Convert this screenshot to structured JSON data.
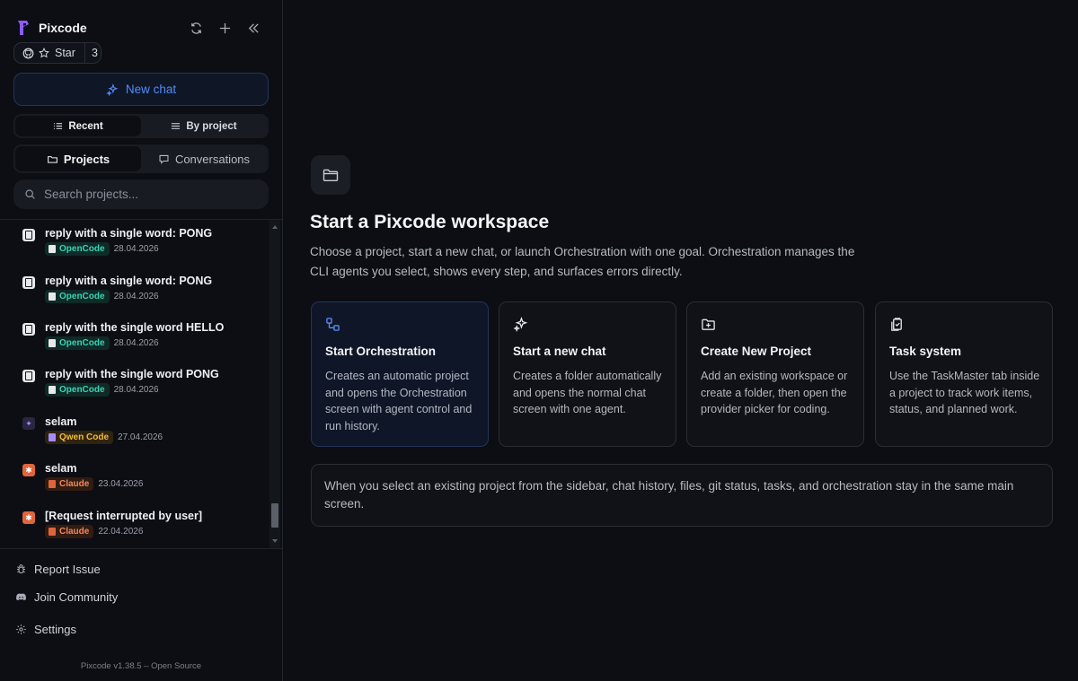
{
  "app": {
    "name": "Pixcode",
    "version_text": "Pixcode v1.38.5 – Open Source"
  },
  "star": {
    "label": "Star",
    "count": "3"
  },
  "new_chat": {
    "label": "New chat"
  },
  "view_toggle": {
    "recent": "Recent",
    "by_project": "By project",
    "active": "Recent"
  },
  "tabs": {
    "projects": "Projects",
    "conversations": "Conversations",
    "active": "Projects"
  },
  "search": {
    "placeholder": "Search projects..."
  },
  "sessions": [
    {
      "title": "reply with a single word: PONG",
      "provider": "OpenCode",
      "date": "28.04.2026",
      "icon": "opencode-icon"
    },
    {
      "title": "reply with a single word: PONG",
      "provider": "OpenCode",
      "date": "28.04.2026",
      "icon": "opencode-icon"
    },
    {
      "title": "reply with the single word HELLO",
      "provider": "OpenCode",
      "date": "28.04.2026",
      "icon": "opencode-icon"
    },
    {
      "title": "reply with the single word PONG",
      "provider": "OpenCode",
      "date": "28.04.2026",
      "icon": "opencode-icon"
    },
    {
      "title": "selam",
      "provider": "Qwen Code",
      "date": "27.04.2026",
      "icon": "qwen-icon"
    },
    {
      "title": "selam",
      "provider": "Claude",
      "date": "23.04.2026",
      "icon": "claude-icon"
    },
    {
      "title": "[Request interrupted by user]",
      "provider": "Claude",
      "date": "22.04.2026",
      "icon": "claude-icon"
    }
  ],
  "footer": {
    "report_issue": "Report Issue",
    "join_community": "Join Community",
    "settings": "Settings"
  },
  "main": {
    "title": "Start a Pixcode workspace",
    "description": "Choose a project, start a new chat, or launch Orchestration with one goal. Orchestration manages the CLI agents you select, shows every step, and surfaces errors directly.",
    "cards": [
      {
        "title": "Start Orchestration",
        "body": "Creates an automatic project and opens the Orchestration screen with agent control and run history.",
        "icon": "orchestration-icon"
      },
      {
        "title": "Start a new chat",
        "body": "Creates a folder automatically and opens the normal chat screen with one agent.",
        "icon": "sparkles-icon"
      },
      {
        "title": "Create New Project",
        "body": "Add an existing workspace or create a folder, then open the provider picker for coding.",
        "icon": "folder-plus-icon"
      },
      {
        "title": "Task system",
        "body": "Use the TaskMaster tab inside a project to track work items, status, and planned work.",
        "icon": "clipboard-icon"
      }
    ],
    "info": "When you select an existing project from the sidebar, chat history, files, git status, tasks, and orchestration stay in the same main screen."
  },
  "colors": {
    "accent": "#4f8bff",
    "brand": "#8b5cf6",
    "opencode": "#38d3b4",
    "qwen": "#f4b93a",
    "claude": "#f0885c"
  }
}
